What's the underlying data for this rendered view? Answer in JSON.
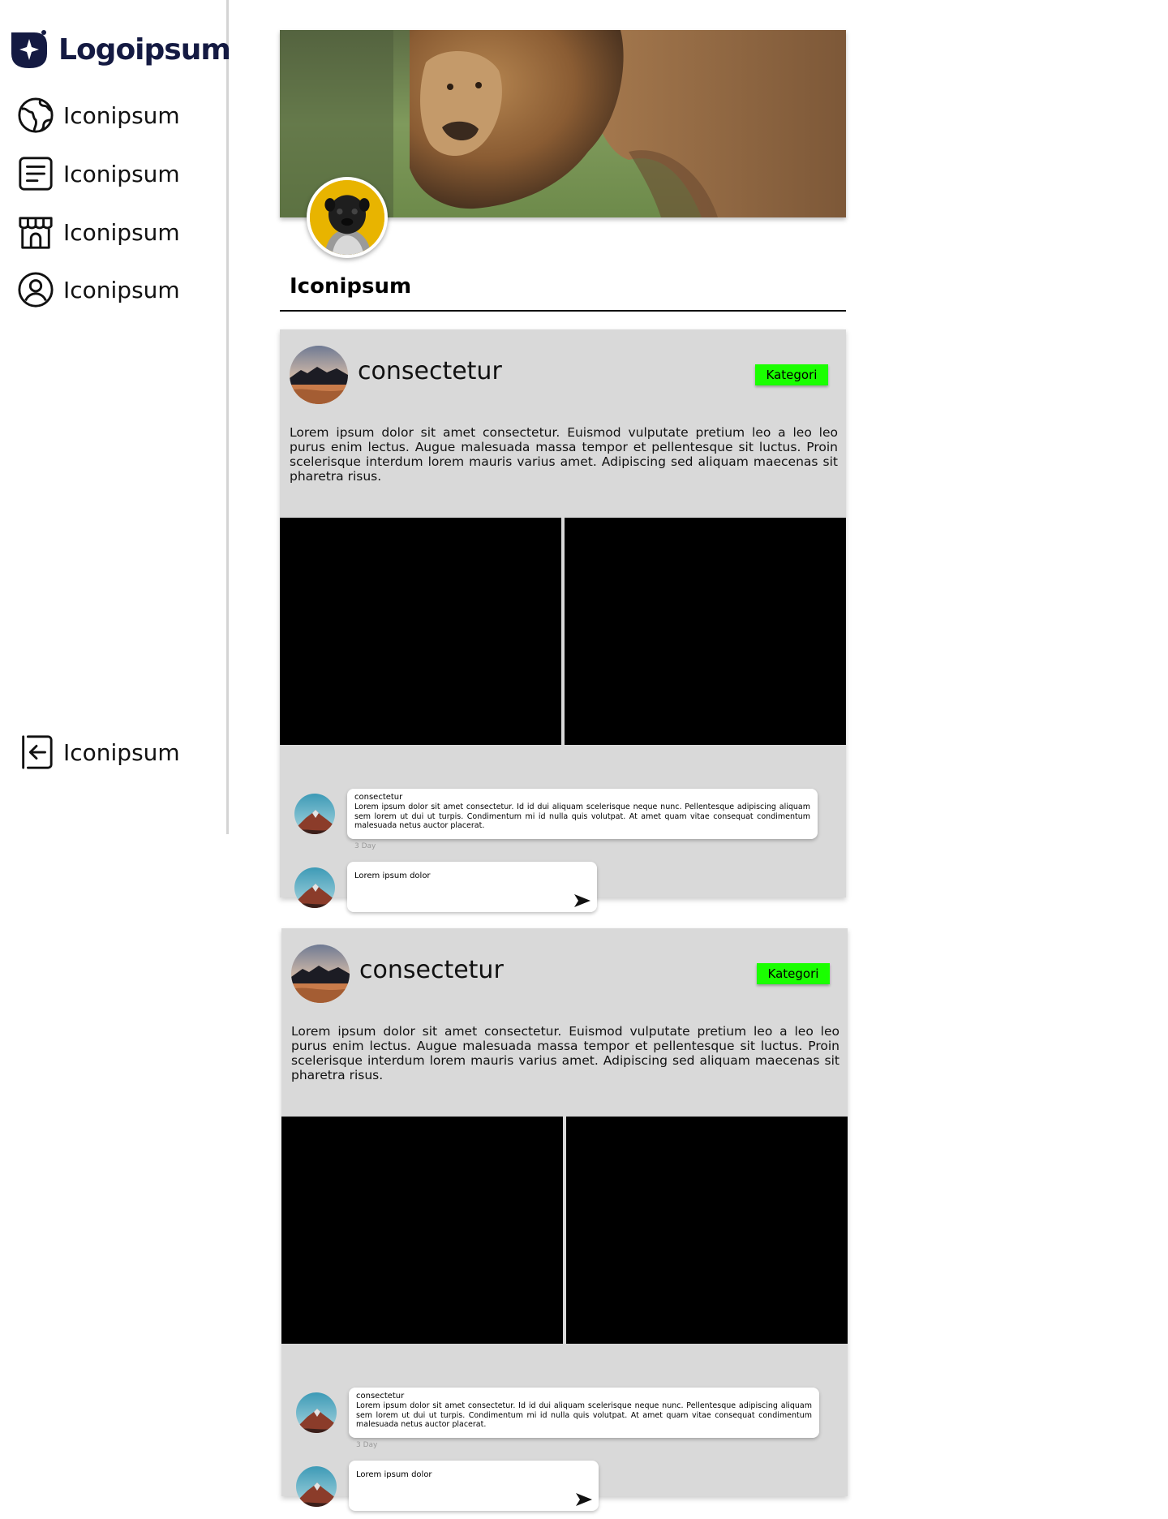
{
  "sidebar": {
    "logo_text": "Logoipsum",
    "nav": [
      {
        "label": "Iconipsum",
        "icon": "globe-icon"
      },
      {
        "label": "Iconipsum",
        "icon": "document-icon"
      },
      {
        "label": "Iconipsum",
        "icon": "store-icon"
      },
      {
        "label": "Iconipsum",
        "icon": "user-circle-icon"
      }
    ],
    "logout": {
      "label": "Iconipsum",
      "icon": "logout-icon"
    }
  },
  "profile": {
    "name": "Iconipsum"
  },
  "posts": [
    {
      "author": "consectetur",
      "category": "Kategori",
      "body": "Lorem ipsum dolor sit amet consectetur. Euismod vulputate pretium leo a leo leo purus enim lectus. Augue malesuada massa tempor et pellentesque sit luctus. Proin scelerisque interdum lorem mauris varius amet. Adipiscing sed aliquam maecenas sit pharetra risus.",
      "comment": {
        "author": "consectetur",
        "text": "Lorem ipsum dolor sit amet consectetur. Id id dui aliquam scelerisque neque nunc. Pellentesque adipiscing aliquam sem lorem ut dui ut turpis. Condimentum mi id nulla quis volutpat. At amet quam vitae consequat condimentum malesuada netus auctor placerat.",
        "time": "3 Day"
      },
      "reply_value": "Lorem ipsum dolor"
    },
    {
      "author": "consectetur",
      "category": "Kategori",
      "body": "Lorem ipsum dolor sit amet consectetur. Euismod vulputate pretium leo a leo leo purus enim lectus. Augue malesuada massa tempor et pellentesque sit luctus. Proin scelerisque interdum lorem mauris varius amet. Adipiscing sed aliquam maecenas sit pharetra risus.",
      "comment": {
        "author": "consectetur",
        "text": "Lorem ipsum dolor sit amet consectetur. Id id dui aliquam scelerisque neque nunc. Pellentesque adipiscing aliquam sem lorem ut dui ut turpis. Condimentum mi id nulla quis volutpat. At amet quam vitae consequat condimentum malesuada netus auctor placerat.",
        "time": "3 Day"
      },
      "reply_value": "Lorem ipsum dolor"
    }
  ],
  "colors": {
    "brand": "#141a42",
    "category_badge": "#1aff00",
    "card_bg": "#d9d9d9",
    "avatar_bg": "#e8b400"
  }
}
